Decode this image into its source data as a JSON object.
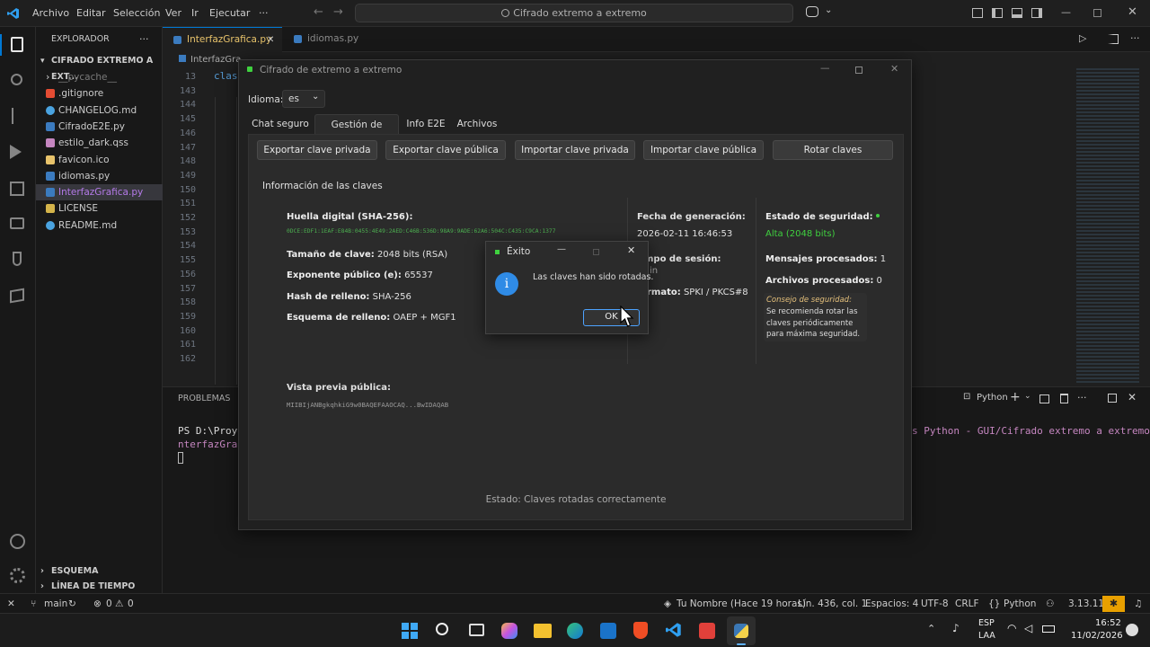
{
  "vscode": {
    "menu": [
      "Archivo",
      "Editar",
      "Selección",
      "Ver",
      "Ir",
      "Ejecutar",
      "···"
    ],
    "command_center": "Cifrado extremo a extremo",
    "explorer_title": "EXPLORADOR",
    "explorer_more": "···",
    "folder": "CIFRADO EXTREMO A EXT...",
    "files": [
      {
        "name": "__pycache__",
        "icon": "folder-icon"
      },
      {
        "name": ".gitignore",
        "icon": "git-icon"
      },
      {
        "name": "CHANGELOG.md",
        "icon": "info-icon"
      },
      {
        "name": "CifradoE2E.py",
        "icon": "python-icon"
      },
      {
        "name": "estilo_dark.qss",
        "icon": "style-icon"
      },
      {
        "name": "favicon.ico",
        "icon": "star-icon"
      },
      {
        "name": "idiomas.py",
        "icon": "python-icon"
      },
      {
        "name": "InterfazGrafica.py",
        "icon": "python-icon"
      },
      {
        "name": "LICENSE",
        "icon": "license-icon"
      },
      {
        "name": "README.md",
        "icon": "info-icon"
      }
    ],
    "outline_label": "ESQUEMA",
    "timeline_label": "LÍNEA DE TIEMPO",
    "tabs": [
      {
        "label": "InterfazGrafica.py",
        "close": "✕"
      },
      {
        "label": "idiomas.py",
        "close": ""
      }
    ],
    "breadcrumb": "InterfazGra",
    "code_line_13": "clas",
    "line_numbers": [
      "13",
      "143",
      "144",
      "145",
      "146",
      "147",
      "148",
      "149",
      "150",
      "151",
      "152",
      "153",
      "154",
      "155",
      "156",
      "157",
      "158",
      "159",
      "160",
      "161",
      "162"
    ],
    "panel_title": "PROBLEMAS",
    "terminal_line1": "PS D:\\Proye",
    "terminal_line2": "nterfazGraf",
    "terminal_right": "s Python - GUI/Cifrado extremo a extremo/I",
    "terminal_profile": "Python",
    "status": {
      "branch": "main",
      "errors": "0",
      "warnings": "0",
      "blame": "Tu Nombre (Hace 19 horas)",
      "position": "Lín. 436, col. 1",
      "spaces": "Espacios: 4",
      "encoding": "UTF-8",
      "eol": "CRLF",
      "language": "Python",
      "version": "3.13.11"
    }
  },
  "taskbar": {
    "lang": "ESP",
    "region": "LAA",
    "time": "16:52",
    "date": "11/02/2026"
  },
  "app": {
    "title": "Cifrado de extremo a extremo",
    "language_label": "Idioma:",
    "language_value": "es",
    "tabs": [
      "Chat seguro",
      "Gestión de claves",
      "Info E2E",
      "Archivos"
    ],
    "active_tab": "Gestión de claves",
    "buttons": [
      "Exportar clave privada",
      "Exportar clave pública",
      "Importar clave privada",
      "Importar clave pública",
      "Rotar claves"
    ],
    "section_title": "Información de las claves",
    "fingerprint_label": "Huella digital (SHA-256):",
    "fingerprint_value": "0DCE:EDF1:1EAF:E84B:0455:4E49:2AED:C46B:536D:98A9:9ADE:62A6:504C:C435:C9CA:1377",
    "key_size_label": "Tamaño de clave:",
    "key_size_value": "2048 bits (RSA)",
    "exponent_label": "Exponente público (e):",
    "exponent_value": "65537",
    "padding_hash_label": "Hash de relleno:",
    "padding_hash_value": "SHA-256",
    "padding_scheme_label": "Esquema de relleno:",
    "padding_scheme_value": "OAEP + MGF1",
    "gen_date_label": "Fecha de generación:",
    "gen_date_value": "2026-02-11 16:46:53",
    "session_time_label": "mpo de sesión:",
    "session_time_value": "in",
    "format_label": "rmato:",
    "format_value": "SPKI / PKCS#8",
    "security_label": "Estado de seguridad:",
    "security_value": "Alta (2048 bits)",
    "messages_label": "Mensajes procesados:",
    "messages_value": "1",
    "files_label": "Archivos procesados:",
    "files_value": "0",
    "tip_title": "Consejo de seguridad:",
    "tip_body": "Se recomienda rotar las claves periódicamente para máxima seguridad.",
    "preview_label": "Vista previa pública:",
    "preview_value": "MIIBIjANBgkqhkiG9w0BAQEFAAOCAQ...BwIDAQAB",
    "status_text": "Estado: Claves rotadas correctamente"
  },
  "dialog": {
    "title": "Éxito",
    "message": "Las claves han sido rotadas.",
    "ok": "OK"
  },
  "colors": {
    "accent_green": "#3fd13f",
    "fingerprint_green": "#4caf50",
    "tip_yellow": "#e5c07b",
    "vscode_blue": "#0078d4"
  }
}
